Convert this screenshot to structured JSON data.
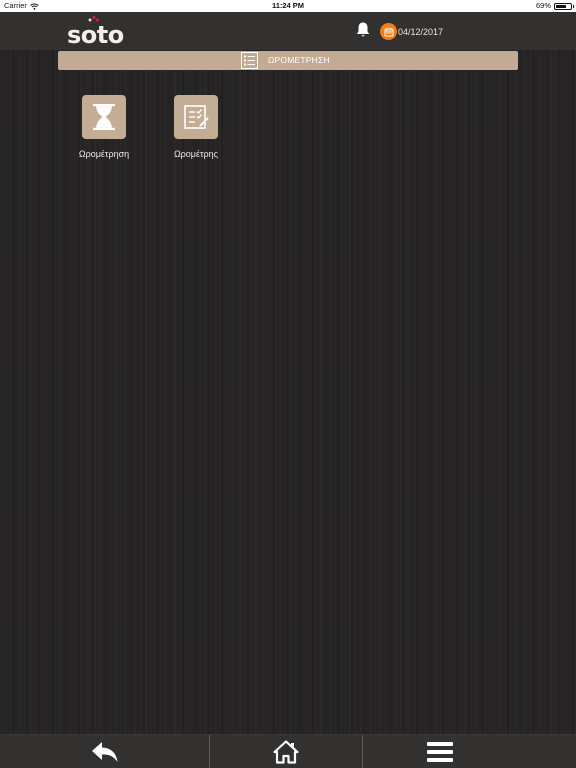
{
  "status_bar": {
    "carrier": "Carrier",
    "time": "11:24 PM",
    "battery_text": "69%",
    "battery_level": 0.69
  },
  "header": {
    "logo_text": "soto",
    "date": "04/12/2017",
    "icons": {
      "notifications": "bell-icon",
      "calendar": "calendar-icon"
    },
    "colors": {
      "background": "#333130",
      "calendar_badge": "#f07d1a"
    }
  },
  "section": {
    "title": "ΩΡΟΜΕΤΡΗΣΗ",
    "icon": "list-icon",
    "color": "#c2ab92"
  },
  "tiles": [
    {
      "label": "Ωρομέτρηση",
      "icon": "hourglass-icon"
    },
    {
      "label": "Ωρομέτρης",
      "icon": "checklist-icon"
    }
  ],
  "bottom_bar": {
    "buttons": [
      {
        "icon": "back-arrow-icon"
      },
      {
        "icon": "home-icon"
      },
      {
        "icon": "menu-icon"
      }
    ]
  }
}
